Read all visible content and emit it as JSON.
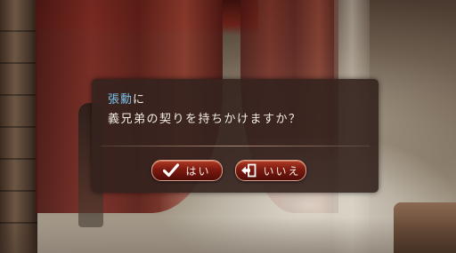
{
  "dialog": {
    "speaker_name": "張勳",
    "speaker_particle": "に",
    "question": "義兄弟の契りを持ちかけますか？",
    "yes_label": "はい",
    "no_label": "いいえ",
    "yes_icon": "checkmark-icon",
    "no_icon": "exit-door-icon"
  },
  "colors": {
    "speaker": "#7fc4ea",
    "text": "#f1ece4",
    "button": "#7c1a10"
  }
}
